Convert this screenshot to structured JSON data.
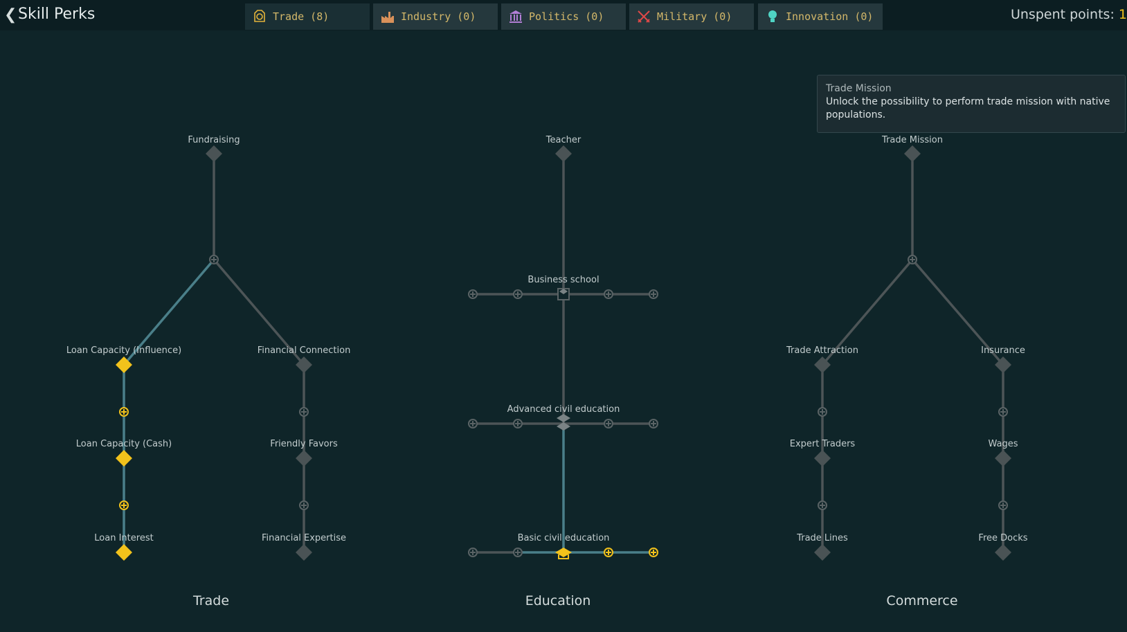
{
  "header": {
    "back_glyph": "❮",
    "title": "Skill Perks",
    "unspent_label": "Unspent points: ",
    "unspent_value": "1"
  },
  "tabs": [
    {
      "label": "Trade (8)",
      "icon": "trade-coin-icon",
      "color": "#e3b43b",
      "active": true
    },
    {
      "label": "Industry (0)",
      "icon": "factory-icon",
      "color": "#d9915a"
    },
    {
      "label": "Politics (0)",
      "icon": "capitol-building-icon",
      "color": "#b27fd6"
    },
    {
      "label": "Military (0)",
      "icon": "crossed-swords-icon",
      "color": "#e04848"
    },
    {
      "label": "Innovation (0)",
      "icon": "lightbulb-icon",
      "color": "#4fd4c4"
    }
  ],
  "tooltip": {
    "title": "Trade Mission",
    "body": "Unlock the possibility to perform trade mission with native populations."
  },
  "trees": {
    "trade": {
      "title": "Trade",
      "nodes": {
        "fundraising": "Fundraising",
        "loan_influence": "Loan Capacity (Influence)",
        "financial_connection": "Financial Connection",
        "loan_cash": "Loan Capacity (Cash)",
        "friendly_favors": "Friendly Favors",
        "loan_interest": "Loan Interest",
        "financial_expertise": "Financial Expertise"
      }
    },
    "education": {
      "title": "Education",
      "nodes": {
        "teacher": "Teacher",
        "business_school": "Business school",
        "advanced_civil": "Advanced civil education",
        "basic_civil": "Basic civil education"
      }
    },
    "commerce": {
      "title": "Commerce",
      "nodes": {
        "trade_mission": "Trade Mission",
        "trade_attraction": "Trade Attraction",
        "insurance": "Insurance",
        "expert_traders": "Expert Traders",
        "wages": "Wages",
        "trade_lines": "Trade Lines",
        "free_docks": "Free Docks"
      }
    }
  },
  "colors": {
    "unlocked": "#f2c21b",
    "locked": "#4a5355",
    "active_link": "#4a7f89",
    "link": "#4d5557"
  }
}
